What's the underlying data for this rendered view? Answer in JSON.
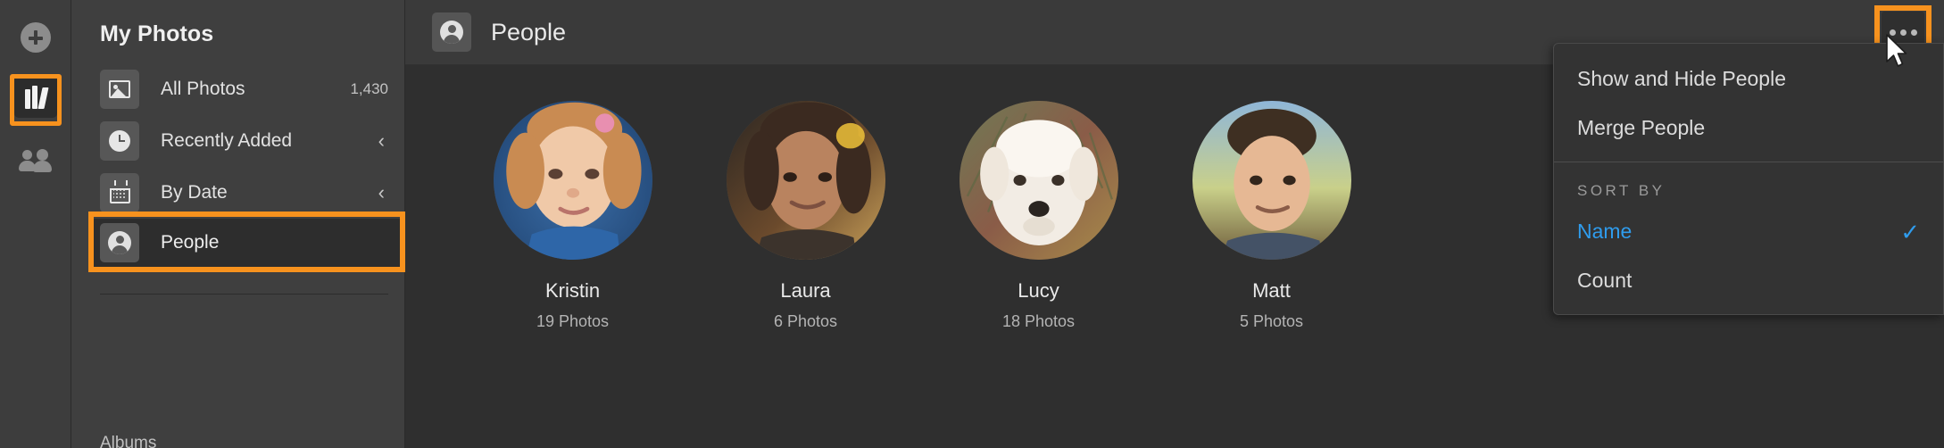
{
  "rail": {
    "add_label": "Add",
    "library_label": "Library",
    "people_label": "People"
  },
  "sidebar": {
    "title": "My Photos",
    "items": [
      {
        "label": "All Photos",
        "icon": "image-icon",
        "count": "1,430",
        "chevron": ""
      },
      {
        "label": "Recently Added",
        "icon": "clock-icon",
        "count": "",
        "chevron": "‹"
      },
      {
        "label": "By Date",
        "icon": "calendar-icon",
        "count": "",
        "chevron": "‹"
      },
      {
        "label": "People",
        "icon": "person-icon",
        "count": "",
        "chevron": ""
      }
    ],
    "footer_label": "Albums"
  },
  "header": {
    "title": "People",
    "icon": "person-icon",
    "more_label": "•••"
  },
  "menu": {
    "items": [
      {
        "label": "Show and Hide People",
        "selected": false
      },
      {
        "label": "Merge People",
        "selected": false
      }
    ],
    "section_label": "SORT BY",
    "sort_options": [
      {
        "label": "Name",
        "selected": true,
        "check": "✓"
      },
      {
        "label": "Count",
        "selected": false,
        "check": ""
      }
    ]
  },
  "people": [
    {
      "name": "Kristin",
      "count": "19 Photos"
    },
    {
      "name": "Laura",
      "count": "6 Photos"
    },
    {
      "name": "Lucy",
      "count": "18 Photos"
    },
    {
      "name": "Matt",
      "count": "5 Photos"
    }
  ],
  "colors": {
    "accent_highlight": "#f7921e",
    "selected_blue": "#2f9ced",
    "panel_bg": "#3f3f3f",
    "grid_bg": "#2f2f2f"
  }
}
